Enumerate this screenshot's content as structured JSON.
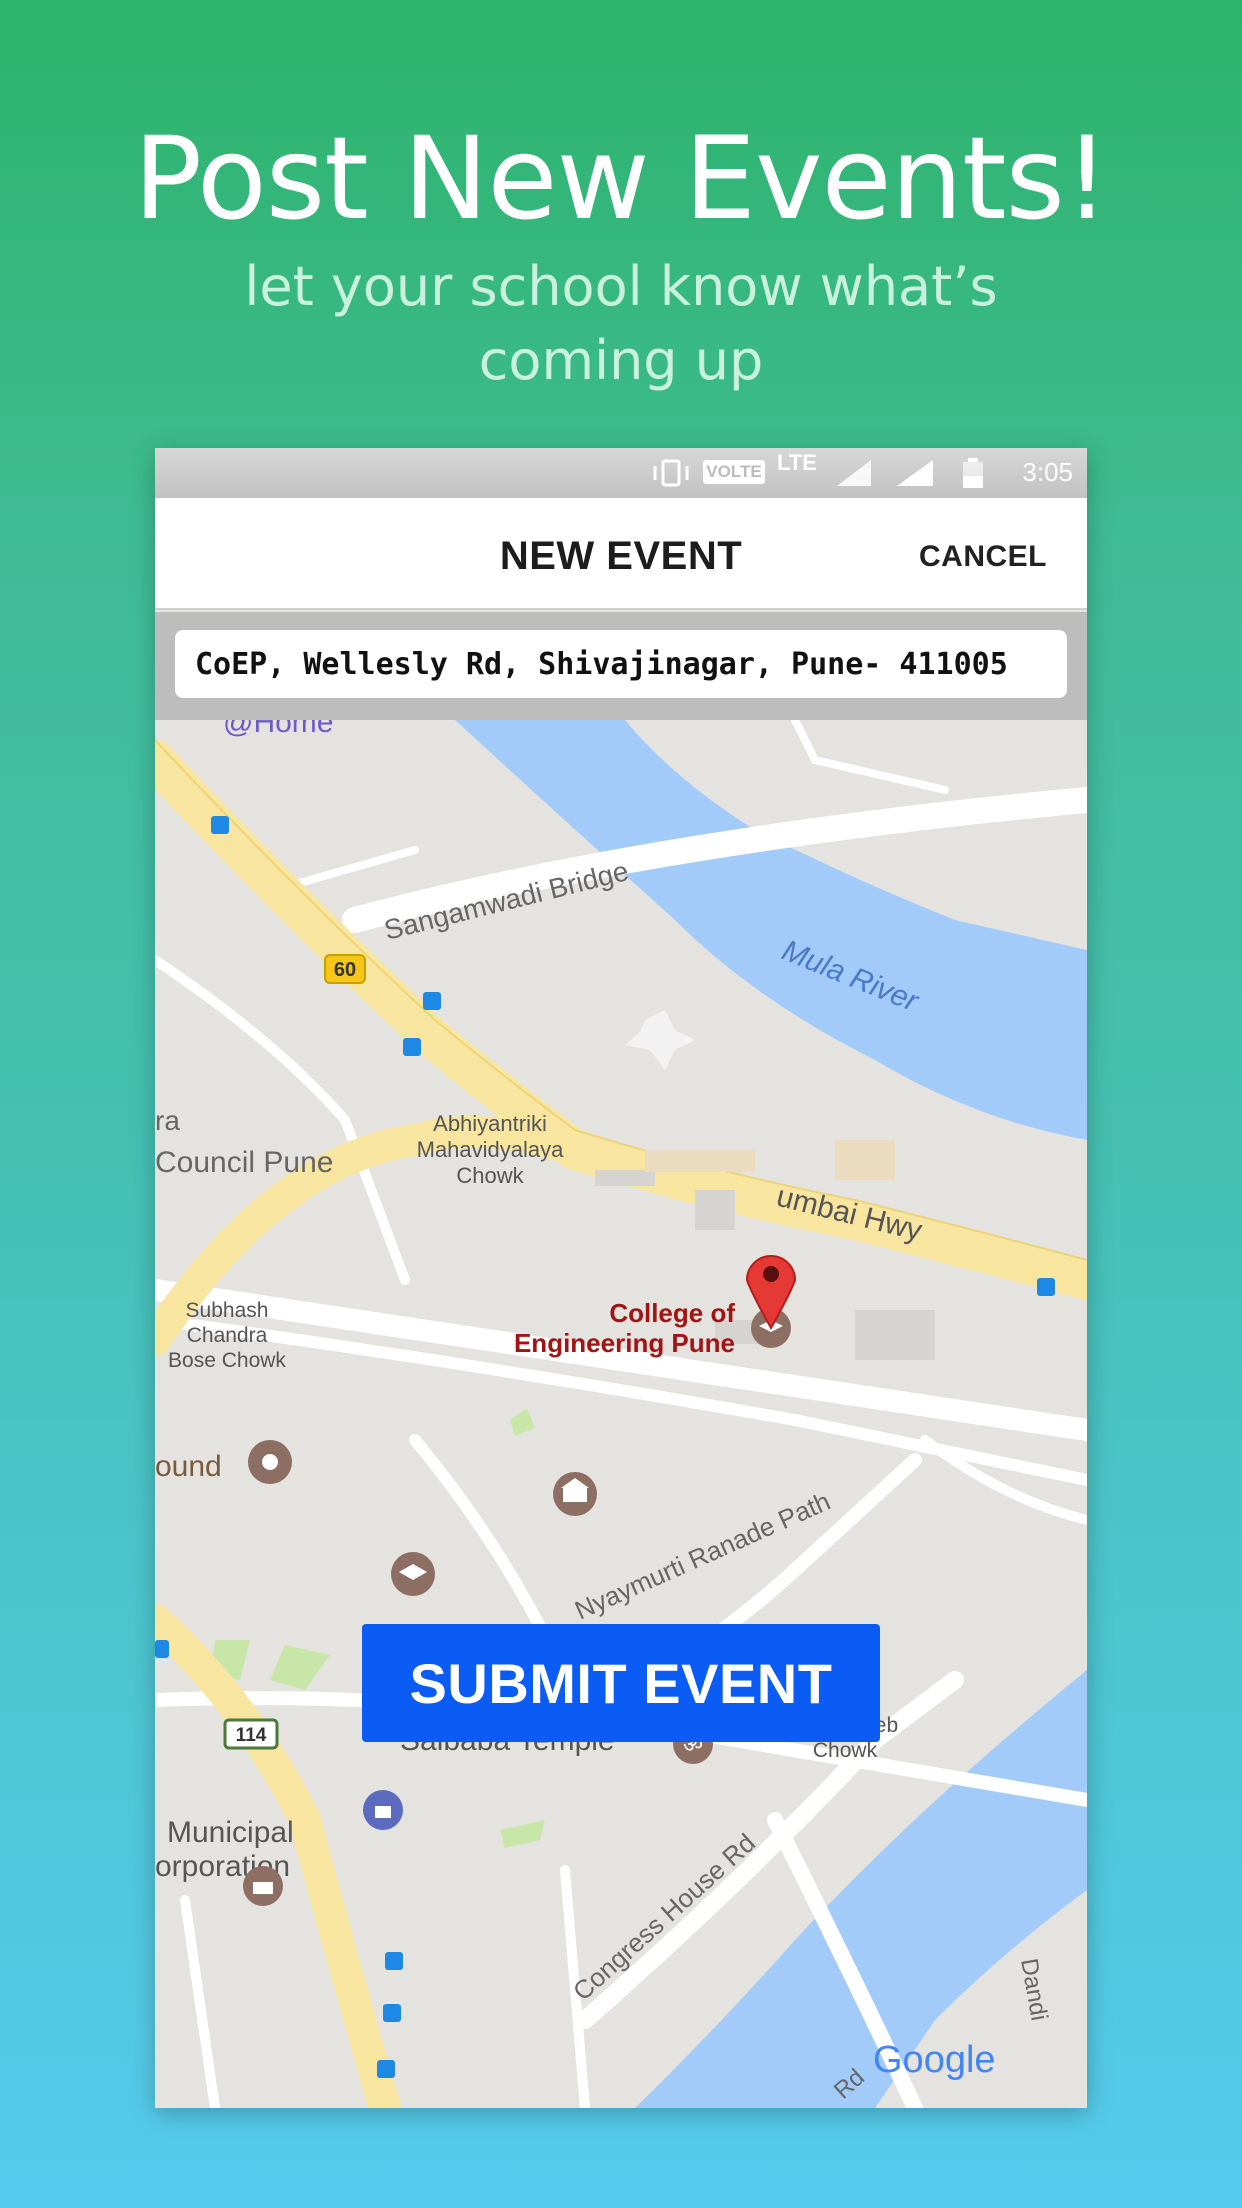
{
  "hero": {
    "title": "Post New Events!",
    "subtitle_line1": "let your school know what’s",
    "subtitle_line2": "coming up"
  },
  "status_bar": {
    "time": "3:05",
    "volte": "VOLTE",
    "network": "LTE"
  },
  "app_bar": {
    "title": "NEW EVENT",
    "cancel_label": "CANCEL"
  },
  "location_input": {
    "value": "CoEP, Wellesly Rd, Shivajinagar, Pune- 411005"
  },
  "map": {
    "labels": {
      "home": "@Home",
      "bridge": "Sangamwadi Bridge",
      "river": "Mula River",
      "chowk1_l1": "Abhiyantriki",
      "chowk1_l2": "Mahavidyalaya",
      "chowk1_l3": "Chowk",
      "council": "Council Pune",
      "council_prefix": "ra",
      "highway": "umbai Hwy",
      "college_l1": "College of",
      "college_l2": "Engineering Pune",
      "subhash_l1": "Subhash",
      "subhash_l2": "Chandra",
      "subhash_l3": "Bose Chowk",
      "ground": "ound",
      "ranade": "Nyaymurti Ranade Path",
      "saibaba": "Saibaba Temple",
      "annasaheb_l1": "Annasaheb",
      "annasaheb_l2": "Chowk",
      "municipal_l1": "Municipal",
      "municipal_l2": "orporation",
      "congress": "Congress House Rd",
      "dandi": "Dandi",
      "rd": "Rd",
      "route60": "60",
      "route114": "114",
      "google": "Google"
    },
    "colors": {
      "land": "#e5e3df",
      "water": "#a3cbfa",
      "highway": "#f8e6a0",
      "road": "#ffffff",
      "park": "#c8e6a8",
      "pin": "#e53935"
    }
  },
  "submit_button": {
    "label": "SUBMIT EVENT"
  }
}
